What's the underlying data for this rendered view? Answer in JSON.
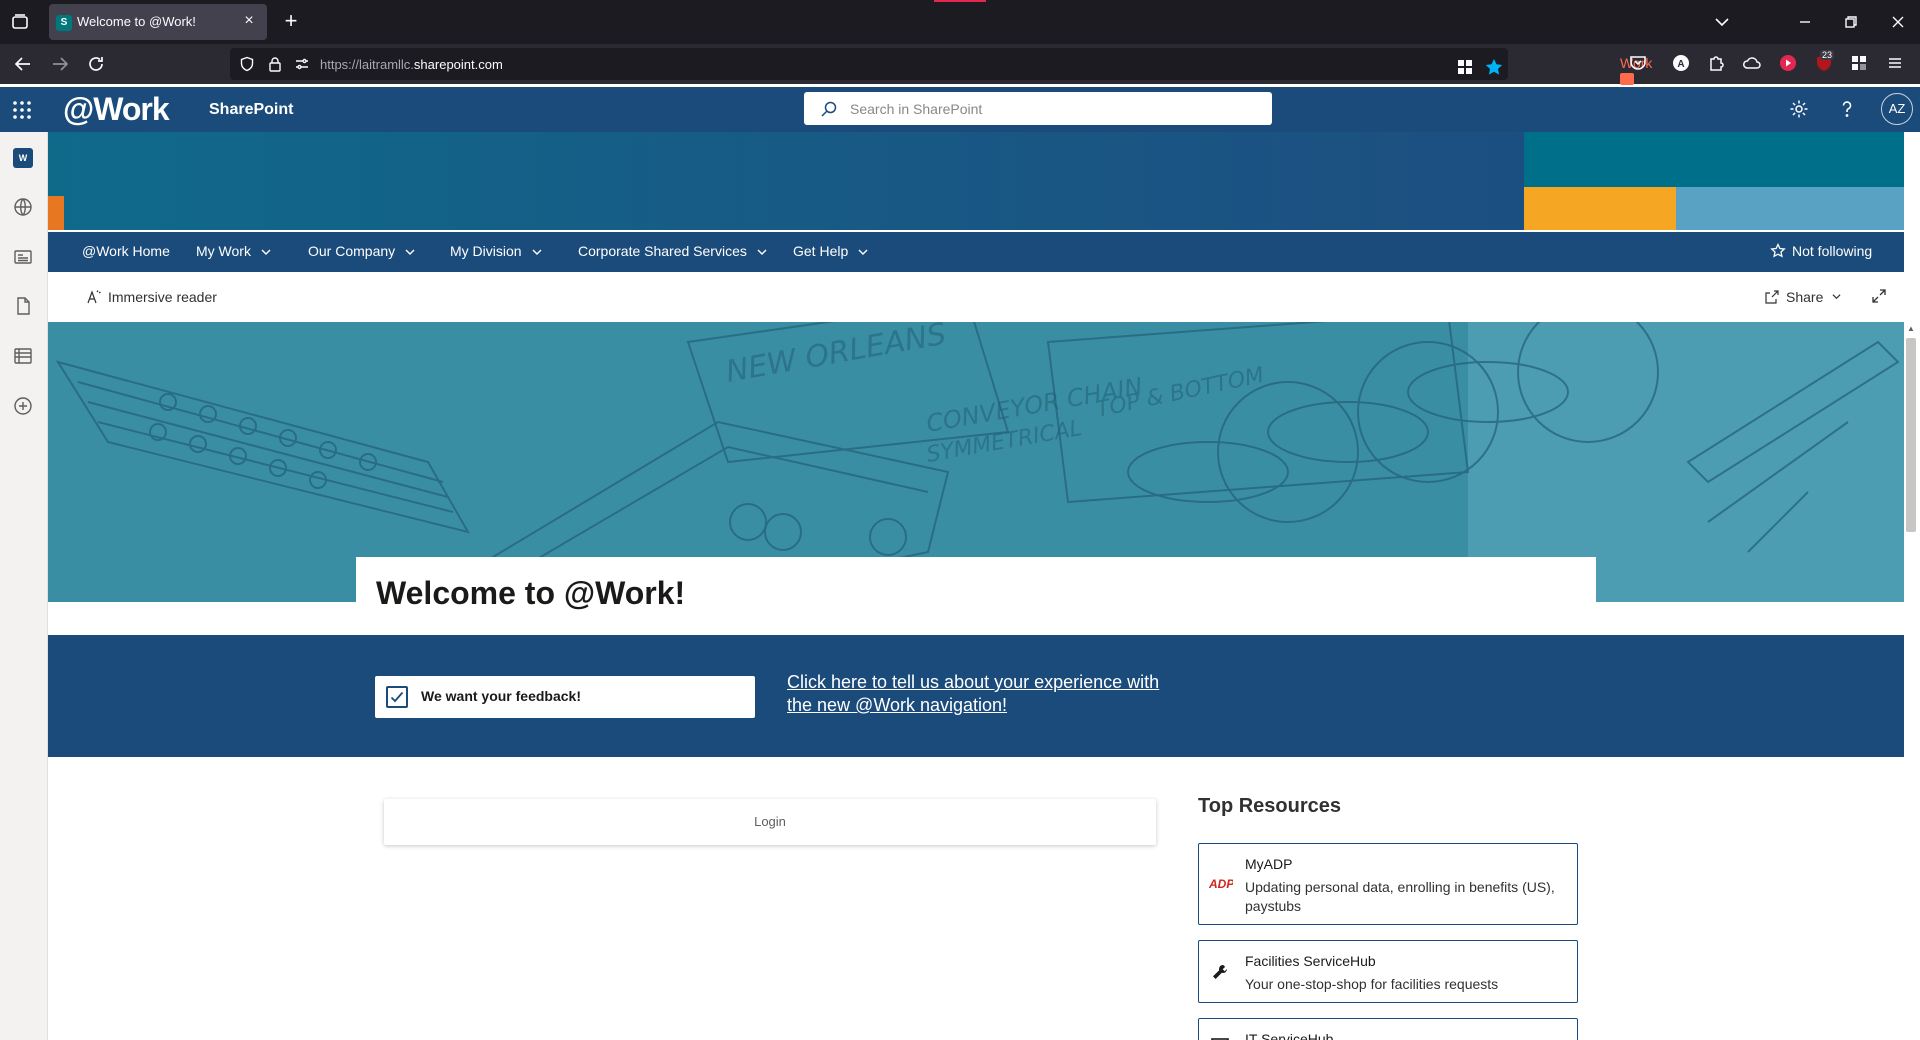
{
  "browser": {
    "tab_title": "Welcome to @Work!",
    "tab_favicon_text": "S",
    "url_prefix": "https://laitramllc.",
    "url_domain": "sharepoint.com",
    "bookmark_label": "Work",
    "notification_count": "23"
  },
  "suitebar": {
    "logo": "@Work",
    "app_name": "SharePoint",
    "search_placeholder": "Search in SharePoint",
    "avatar_initials": "AZ"
  },
  "appbar": {
    "site_icon_text": "W"
  },
  "megamenu": {
    "items": [
      {
        "label": "@Work Home",
        "has_chevron": false
      },
      {
        "label": "My Work",
        "has_chevron": true
      },
      {
        "label": "Our Company",
        "has_chevron": true
      },
      {
        "label": "My Division",
        "has_chevron": true
      },
      {
        "label": "Corporate Shared Services",
        "has_chevron": true
      },
      {
        "label": "Get Help",
        "has_chevron": true
      }
    ],
    "follow_label": "Not following"
  },
  "commandbar": {
    "immersive_reader": "Immersive reader",
    "share": "Share"
  },
  "hero": {
    "sketch_texts": [
      "NEW ORLEANS",
      "CONVEYOR CHAIN",
      "SYMMETRICAL",
      "TOP & BOTTOM"
    ]
  },
  "page": {
    "title": "Welcome to @Work!"
  },
  "feedback": {
    "card_text": "We want your feedback!",
    "link_line1": "Click here to tell us about your experience with",
    "link_line2": "the new @Work navigation!"
  },
  "login": {
    "label": "Login"
  },
  "resources": {
    "heading": "Top Resources",
    "items": [
      {
        "title": "MyADP",
        "desc": "Updating personal data, enrolling in benefits (US), paystubs",
        "icon": "adp-logo-icon",
        "icon_text": "ADP"
      },
      {
        "title": "Facilities ServiceHub",
        "desc": "Your one-stop-shop for facilities requests",
        "icon": "wrench-icon"
      },
      {
        "title": "IT ServiceHub",
        "desc": "",
        "icon": "monitor-icon"
      }
    ]
  },
  "colors": {
    "brand_navy": "#1b4b7b",
    "hero_teal": "#3a8ea3",
    "accent_orange": "#e87722",
    "accent_yellow": "#f5a623"
  }
}
